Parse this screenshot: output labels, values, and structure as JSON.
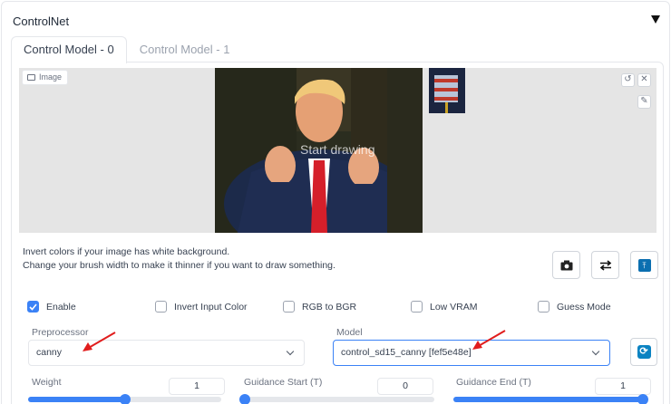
{
  "panel": {
    "title": "ControlNet"
  },
  "tabs": [
    {
      "label": "Control Model - 0",
      "active": true
    },
    {
      "label": "Control Model - 1",
      "active": false
    }
  ],
  "canvas": {
    "image_label": "Image",
    "overlay_text": "Start drawing"
  },
  "hint": {
    "line1": "Invert colors if your image has white background.",
    "line2": "Change your brush width to make it thinner if you want to draw something."
  },
  "options": {
    "enable": {
      "label": "Enable",
      "checked": true
    },
    "invert_input_color": {
      "label": "Invert Input Color",
      "checked": false
    },
    "rgb_to_bgr": {
      "label": "RGB to BGR",
      "checked": false
    },
    "low_vram": {
      "label": "Low VRAM",
      "checked": false
    },
    "guess_mode": {
      "label": "Guess Mode",
      "checked": false
    }
  },
  "preprocessor": {
    "label": "Preprocessor",
    "value": "canny"
  },
  "model": {
    "label": "Model",
    "value": "control_sd15_canny [fef5e48e]"
  },
  "sliders": {
    "weight": {
      "label": "Weight",
      "value": "1",
      "fraction": 0.5
    },
    "guidance_start": {
      "label": "Guidance Start (T)",
      "value": "0",
      "fraction": 0.0
    },
    "guidance_end": {
      "label": "Guidance End (T)",
      "value": "1",
      "fraction": 1.0
    }
  },
  "colors": {
    "accent": "#3b82f6",
    "annotation_arrow": "#e11d1d"
  }
}
